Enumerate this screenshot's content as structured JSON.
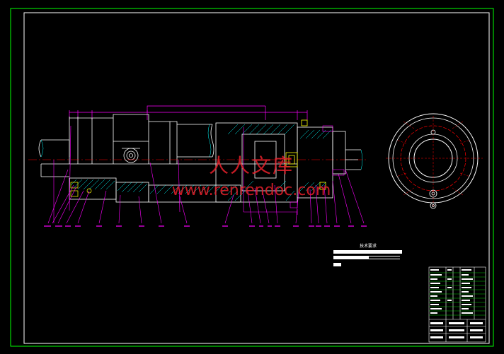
{
  "watermark": {
    "cn_text": "人人文库",
    "url_text": "www.renrendoc.com",
    "color": "#e8202a"
  },
  "tech_requirements": {
    "title": "技术要求"
  },
  "colors": {
    "frame": "#00ff00",
    "outline": "#ffffff",
    "dimension": "#ff00ff",
    "hatch": "#00ffff",
    "centerline": "#ff0000",
    "part": "#ffff00"
  }
}
